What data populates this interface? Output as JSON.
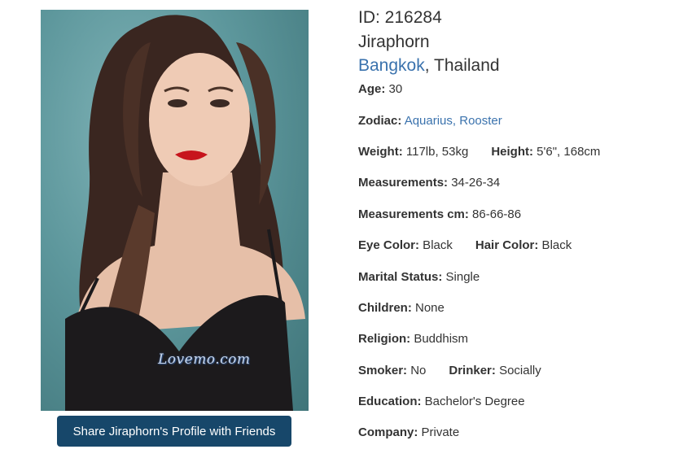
{
  "profile": {
    "id_text": "ID: 216284",
    "name": "Jiraphorn",
    "city": "Bangkok",
    "country_sep": ", ",
    "country": "Thailand"
  },
  "photo": {
    "watermark": "Lovemo.com"
  },
  "share_button": "Share Jiraphorn's Profile with Friends",
  "details": {
    "age": {
      "label": "Age:",
      "value": " 30"
    },
    "zodiac": {
      "label": "Zodiac:",
      "value1": "Aquarius",
      "sep": ", ",
      "value2": "Rooster"
    },
    "weight": {
      "label": "Weight:",
      "value": " 117lb, 53kg"
    },
    "height": {
      "label": "Height:",
      "value": " 5'6\", 168cm"
    },
    "measurements": {
      "label": "Measurements:",
      "value": " 34-26-34"
    },
    "measurements_cm": {
      "label": "Measurements cm:",
      "value": " 86-66-86"
    },
    "eye_color": {
      "label": "Eye Color:",
      "value": " Black"
    },
    "hair_color": {
      "label": "Hair Color:",
      "value": " Black"
    },
    "marital_status": {
      "label": "Marital Status:",
      "value": " Single"
    },
    "children": {
      "label": "Children:",
      "value": " None"
    },
    "religion": {
      "label": "Religion:",
      "value": " Buddhism"
    },
    "smoker": {
      "label": "Smoker:",
      "value": " No"
    },
    "drinker": {
      "label": "Drinker:",
      "value": " Socially"
    },
    "education": {
      "label": "Education:",
      "value": " Bachelor's Degree"
    },
    "company": {
      "label": "Company:",
      "value": " Private"
    }
  },
  "colors": {
    "link": "#3a72ad",
    "button_bg": "#17476a",
    "text": "#333333"
  }
}
